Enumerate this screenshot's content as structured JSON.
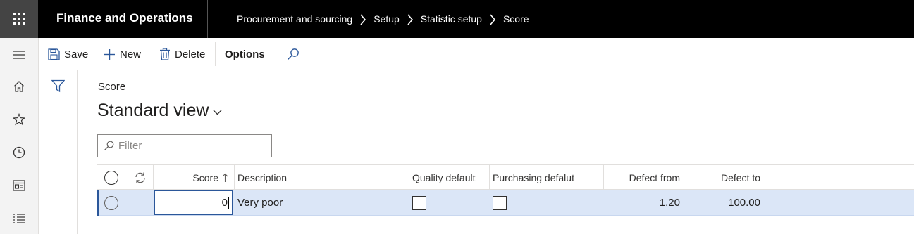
{
  "app": {
    "title": "Finance and Operations",
    "waffle_icon": "waffle-grid-icon",
    "breadcrumb": [
      "Procurement and sourcing",
      "Setup",
      "Statistic setup",
      "Score"
    ]
  },
  "nav": {
    "items": [
      "hamburger-icon",
      "home-icon",
      "star-icon",
      "clock-icon",
      "workspace-icon",
      "list-icon"
    ]
  },
  "toolbar": {
    "save_label": "Save",
    "new_label": "New",
    "delete_label": "Delete",
    "options_label": "Options",
    "search_icon": "search-icon"
  },
  "form": {
    "caption": "Score",
    "view_title": "Standard view",
    "filter_placeholder": "Filter"
  },
  "grid": {
    "columns": [
      "Score",
      "Description",
      "Quality default",
      "Purchasing defalut",
      "Defect from",
      "Defect to"
    ],
    "rows": [
      {
        "score": "0",
        "description": "Very poor",
        "quality_default": false,
        "purchasing_default": false,
        "defect_from": "1.20",
        "defect_to": "100.00"
      }
    ]
  },
  "colors": {
    "topbar": "#000000",
    "accent": "#2b579a",
    "selected_row": "#dbe6f7"
  }
}
